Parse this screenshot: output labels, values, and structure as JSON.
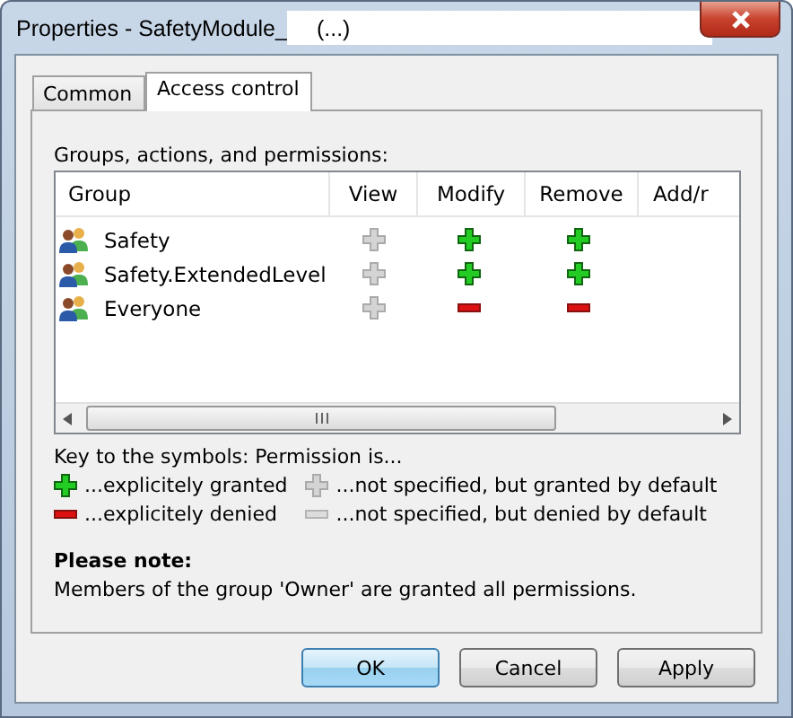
{
  "window": {
    "title": "Properties - SafetyModule_",
    "title_suffix": "(...)"
  },
  "tabs": [
    {
      "label": "Common",
      "selected": false
    },
    {
      "label": "Access control",
      "selected": true
    }
  ],
  "list_label": "Groups, actions, and permissions:",
  "table": {
    "columns": [
      "Group",
      "View",
      "Modify",
      "Remove",
      "Add/r"
    ],
    "rows": [
      {
        "group": "Safety",
        "permissions": [
          {
            "kind": "default_granted"
          },
          {
            "kind": "granted"
          },
          {
            "kind": "granted"
          }
        ]
      },
      {
        "group": "Safety.ExtendedLevel",
        "permissions": [
          {
            "kind": "default_granted"
          },
          {
            "kind": "granted"
          },
          {
            "kind": "granted"
          }
        ]
      },
      {
        "group": "Everyone",
        "permissions": [
          {
            "kind": "default_granted"
          },
          {
            "kind": "denied"
          },
          {
            "kind": "denied"
          }
        ]
      }
    ]
  },
  "key": {
    "title": "Key to the symbols: Permission is...",
    "items": [
      {
        "kind": "granted",
        "label": "...explicitely granted"
      },
      {
        "kind": "default_granted",
        "label": "...not specified, but granted by default"
      },
      {
        "kind": "denied",
        "label": "...explicitely denied"
      },
      {
        "kind": "default_denied",
        "label": "...not specified, but denied by default"
      }
    ]
  },
  "note": {
    "title": "Please note:",
    "text": "Members of the group 'Owner' are granted all permissions."
  },
  "buttons": [
    {
      "label": "OK",
      "default": true
    },
    {
      "label": "Cancel",
      "default": false
    },
    {
      "label": "Apply",
      "default": false
    }
  ]
}
